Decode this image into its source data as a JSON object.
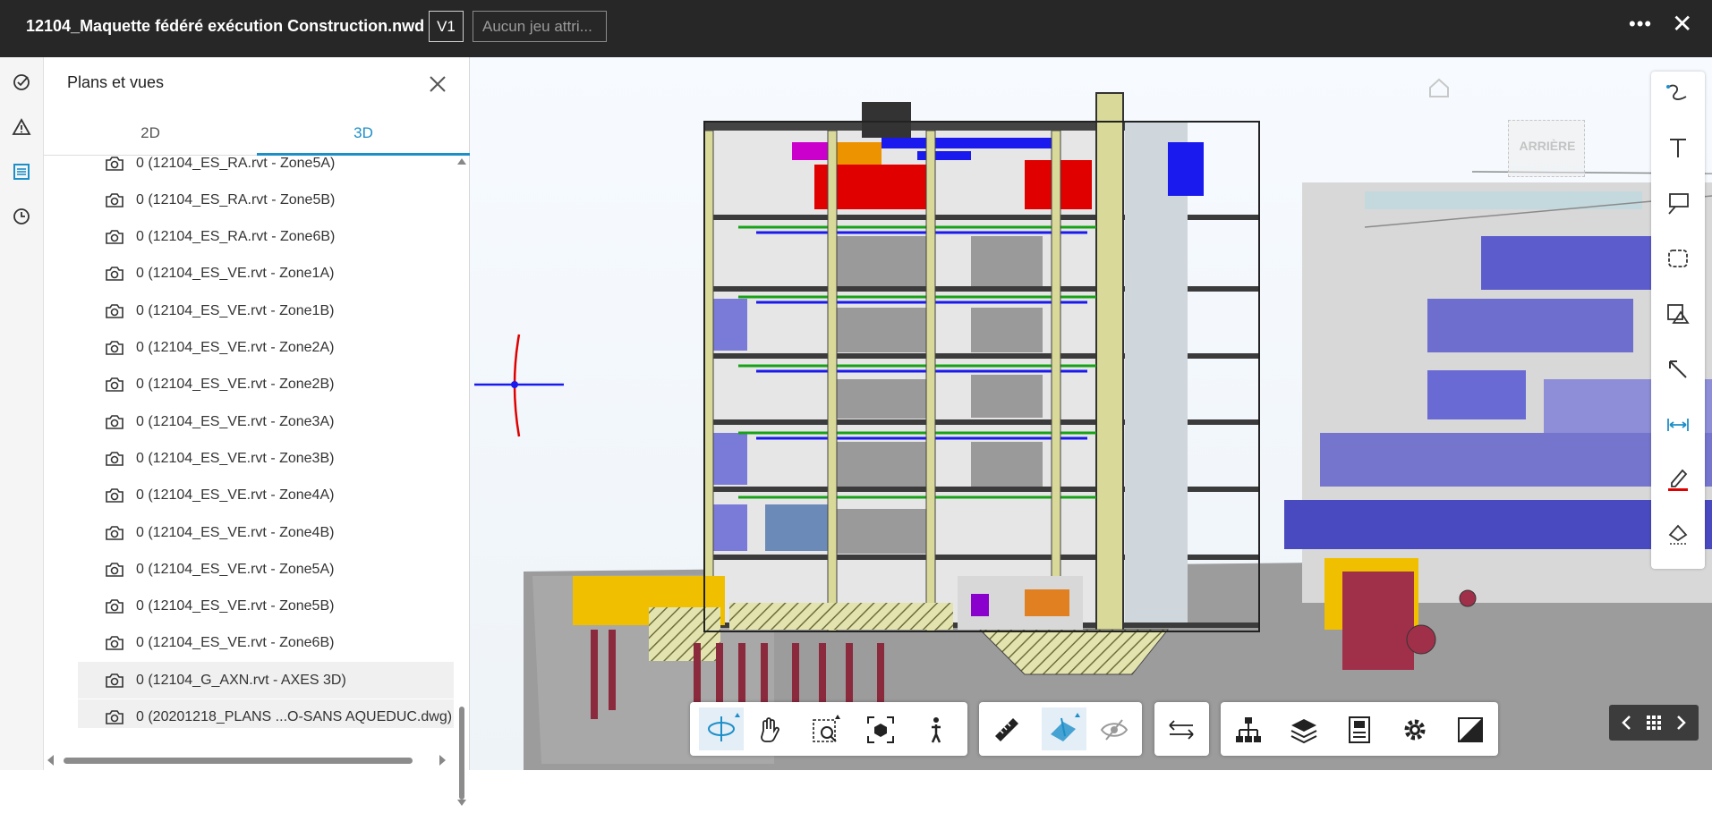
{
  "header": {
    "file_title": "12104_Maquette fédéré exécution Construction.nwd",
    "version": "V1",
    "attribute_set_placeholder": "Aucun jeu attri...",
    "more_label": "•••",
    "close_label": "✕"
  },
  "panel": {
    "title": "Plans et vues",
    "tabs": [
      "2D",
      "3D"
    ],
    "active_tab": "3D",
    "views": [
      "0 (12104_ES_RA.rvt - Zone5A)",
      "0 (12104_ES_RA.rvt - Zone5B)",
      "0 (12104_ES_RA.rvt - Zone6B)",
      "0 (12104_ES_VE.rvt - Zone1A)",
      "0 (12104_ES_VE.rvt - Zone1B)",
      "0 (12104_ES_VE.rvt - Zone2A)",
      "0 (12104_ES_VE.rvt - Zone2B)",
      "0 (12104_ES_VE.rvt - Zone3A)",
      "0 (12104_ES_VE.rvt - Zone3B)",
      "0 (12104_ES_VE.rvt - Zone4A)",
      "0 (12104_ES_VE.rvt - Zone4B)",
      "0 (12104_ES_VE.rvt - Zone5A)",
      "0 (12104_ES_VE.rvt - Zone5B)",
      "0 (12104_ES_VE.rvt - Zone6B)",
      "0 (12104_G_AXN.rvt - AXES 3D)",
      "0 (20201218_PLANS ...O-SANS AQUEDUC.dwg)"
    ]
  },
  "viewcube": {
    "face_label": "ARRIÈRE"
  },
  "colors": {
    "topbar": "#272727",
    "accent": "#1d8fc8",
    "markup_red": "#e00000"
  }
}
